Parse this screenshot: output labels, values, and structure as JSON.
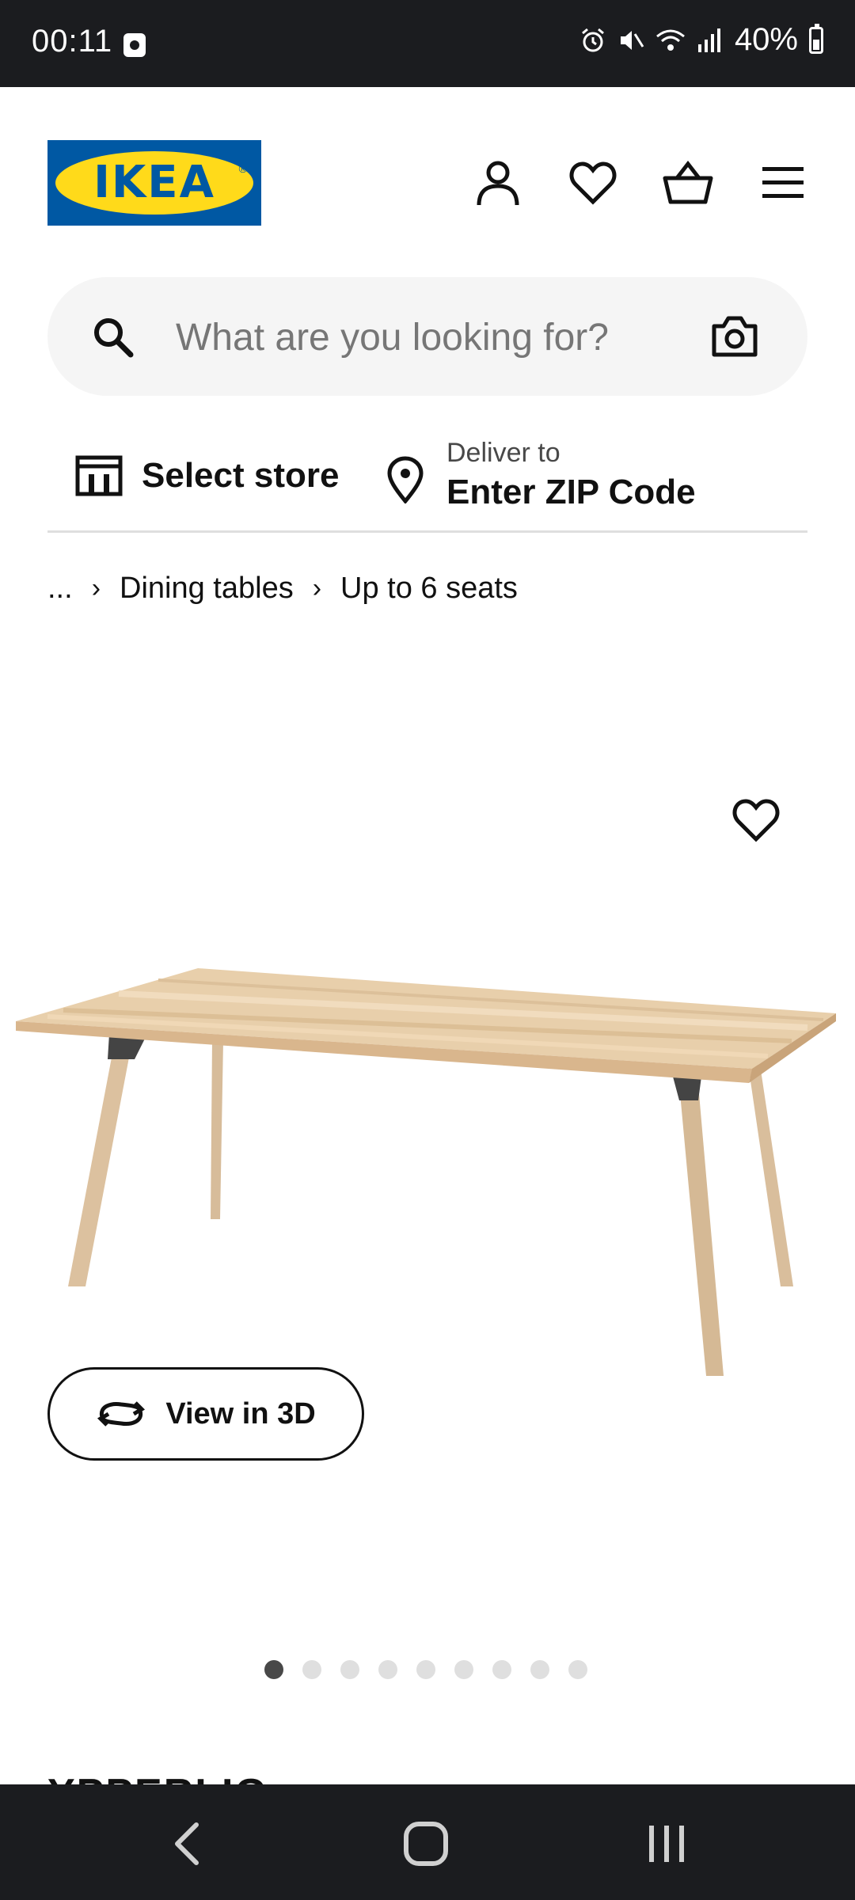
{
  "status_bar": {
    "time": "00:11",
    "battery": "40%",
    "icons": [
      "alarm-icon",
      "mute-icon",
      "wifi-icon",
      "signal-icon",
      "battery-icon"
    ]
  },
  "header": {
    "logo_text": "IKEA",
    "icons": [
      "account-icon",
      "heart-icon",
      "cart-icon",
      "menu-icon"
    ]
  },
  "search": {
    "placeholder": "What are you looking for?"
  },
  "store": {
    "select_label": "Select store",
    "deliver_small": "Deliver to",
    "deliver_big": "Enter ZIP Code"
  },
  "breadcrumb": {
    "items": [
      "...",
      "Dining tables",
      "Up to 6 seats"
    ]
  },
  "product": {
    "view3d_label": "View in 3D",
    "carousel_count": 9,
    "carousel_active": 1,
    "name_partial": "YPPERLIG"
  },
  "colors": {
    "ikea_blue": "#0058a3",
    "ikea_yellow": "#ffda1a",
    "system_bar": "#1b1c1f"
  }
}
